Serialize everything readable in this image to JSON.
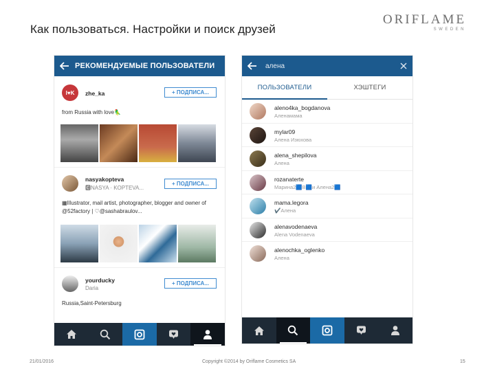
{
  "slide": {
    "title": "Как пользоваться. Настройки и поиск друзей",
    "brand": {
      "name": "ORIFLAME",
      "sub": "SWEDEN"
    },
    "footer": {
      "date": "21/01/2016",
      "copyright": "Copyright ©2014 by Oriflame Cosmetics SA",
      "page": "15"
    }
  },
  "left_screen": {
    "header_title": "РЕКОМЕНДУЕМЫЕ ПОЛЬЗОВАТЕЛИ",
    "follow_label": "+ ПОДПИСА...",
    "users": [
      {
        "username": "zhe_ka",
        "subtitle": "",
        "avatar_text": "I♥K",
        "bio": "from Russia with love🦜"
      },
      {
        "username": "nasyakopteva",
        "subtitle": "🅲NASYA · KOPTEVA...",
        "avatar_text": "",
        "bio": "▦Illustrator, mail artist, photographer, blogger and owner of @52factory | ♡@sashabraulov..."
      },
      {
        "username": "yourducky",
        "subtitle": "Daria",
        "avatar_text": "",
        "bio": "Russia,Saint-Petersburg"
      }
    ],
    "nav_icons": [
      "home-icon",
      "search-icon",
      "camera-icon",
      "activity-icon",
      "profile-icon"
    ]
  },
  "right_screen": {
    "search_query": "алена",
    "tabs": {
      "users": "ПОЛЬЗОВАТЕЛИ",
      "hashtags": "ХЭШТЕГИ"
    },
    "results": [
      {
        "username": "aleno4ka_bogdanova",
        "name": "Аленамама"
      },
      {
        "username": "mylar09",
        "name": "Алена Изюхова"
      },
      {
        "username": "alena_shepilova",
        "name": "Алена"
      },
      {
        "username": "rozanaterte",
        "name": "Марина2🟦В🟦и Алена2🟦"
      },
      {
        "username": "mama.legora",
        "name": "✔️Алена"
      },
      {
        "username": "alenavodenaeva",
        "name": "Alena Vodenaeva"
      },
      {
        "username": "alenochka_oglenko",
        "name": "Алена"
      }
    ]
  },
  "colors": {
    "app_bar": "#1c5a8e",
    "follow_blue": "#3f8bd0",
    "bottom_bar": "#1e2a36",
    "active_tab": "#1b6aa6"
  }
}
